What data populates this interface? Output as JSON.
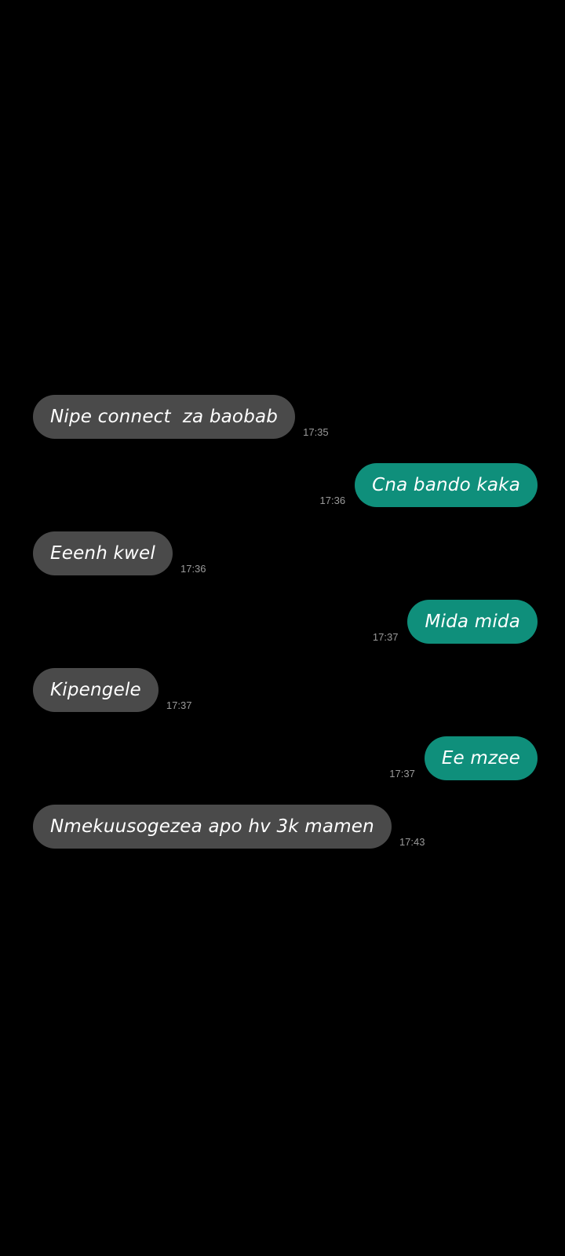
{
  "conversation": {
    "colors": {
      "background": "#000000",
      "incoming_bubble": "#4a4a4a",
      "outgoing_bubble": "#0f8f7b",
      "timestamp": "#9a9a9a"
    },
    "messages": [
      {
        "direction": "incoming",
        "text": "Nipe connect  za baobab",
        "time": "17:35"
      },
      {
        "direction": "outgoing",
        "text": "Cna bando kaka",
        "time": "17:36"
      },
      {
        "direction": "incoming",
        "text": "Eeenh kwel",
        "time": "17:36"
      },
      {
        "direction": "outgoing",
        "text": "Mida mida",
        "time": "17:37"
      },
      {
        "direction": "incoming",
        "text": "Kipengele",
        "time": "17:37"
      },
      {
        "direction": "outgoing",
        "text": "Ee mzee",
        "time": "17:37"
      },
      {
        "direction": "incoming",
        "text": "Nmekuusogezea apo hv 3k mamen",
        "time": "17:43"
      }
    ]
  }
}
